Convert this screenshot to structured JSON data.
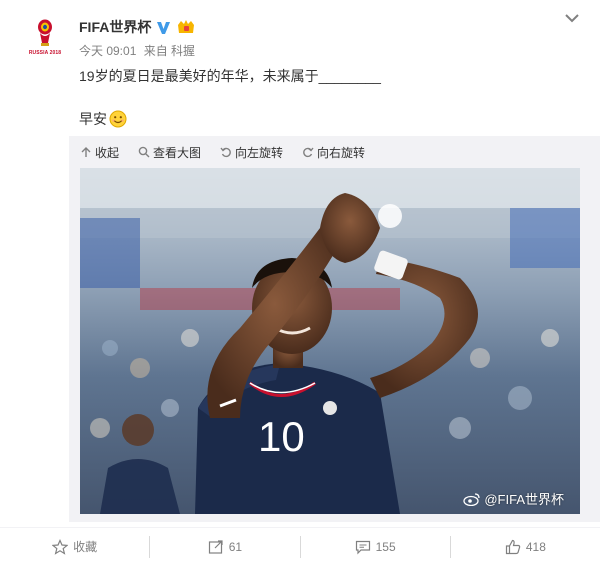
{
  "header": {
    "username": "FIFA世界杯",
    "avatar_caption": "RUSSIA 2018",
    "time": "今天 09:01",
    "source": "来自 科握"
  },
  "post": {
    "line1": "19岁的夏日是最美好的年华，未来属于________",
    "line2": "早安"
  },
  "media_toolbar": {
    "collapse": "收起",
    "view_large": "查看大图",
    "rotate_left": "向左旋转",
    "rotate_right": "向右旋转"
  },
  "photo": {
    "jersey_number": "10",
    "watermark": "@FIFA世界杯"
  },
  "footer": {
    "favorite": "收藏",
    "repost_count": "61",
    "comment_count": "155",
    "like_count": "418"
  },
  "colors": {
    "accent": "#eb7350",
    "text": "#333333",
    "muted": "#808080",
    "panel": "#f2f2f5",
    "jersey": "#1b2a4a"
  },
  "icons": [
    "fifa-logo",
    "verified-icon",
    "member-icon",
    "chevron-down-icon",
    "smile-icon",
    "collapse-icon",
    "search-icon",
    "rotate-left-icon",
    "rotate-right-icon",
    "weibo-icon",
    "star-icon",
    "repost-icon",
    "comment-icon",
    "like-icon"
  ]
}
